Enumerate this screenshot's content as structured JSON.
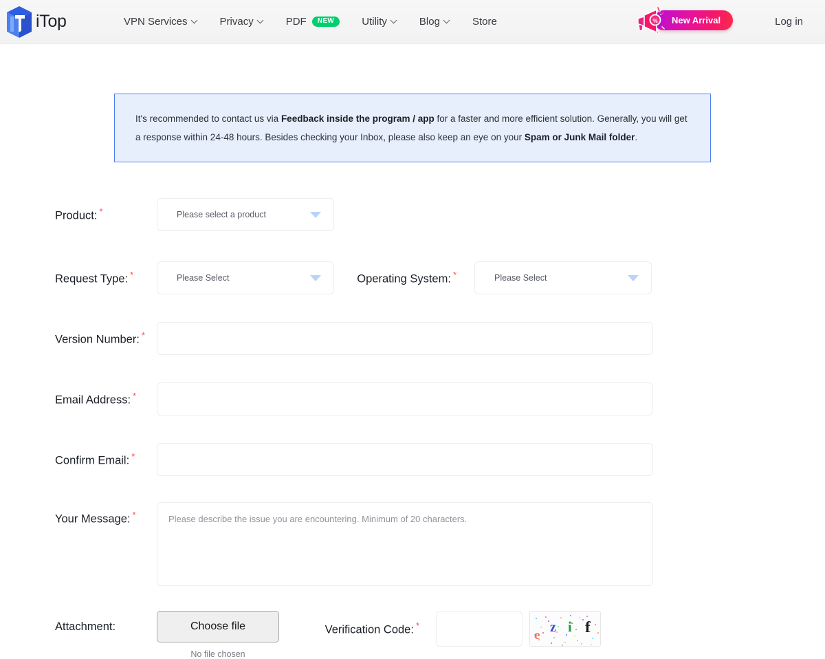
{
  "header": {
    "logo_text": "iTop",
    "logo_icon": "itop-cube-logo",
    "nav": [
      {
        "label": "VPN Services",
        "has_caret": true,
        "badge": null
      },
      {
        "label": "Privacy",
        "has_caret": true,
        "badge": null
      },
      {
        "label": "PDF",
        "has_caret": false,
        "badge": "NEW"
      },
      {
        "label": "Utility",
        "has_caret": true,
        "badge": null
      },
      {
        "label": "Blog",
        "has_caret": true,
        "badge": null
      },
      {
        "label": "Store",
        "has_caret": false,
        "badge": null
      }
    ],
    "arrival_badge": {
      "label": "New Arrival",
      "icon": "megaphone-icon"
    },
    "login_label": "Log in"
  },
  "notice": {
    "part1": "It's recommended to contact us via ",
    "bold1": "Feedback inside the program / app",
    "part2": " for a faster and more efficient solution. Generally, you will get a response within 24-48 hours. Besides checking your Inbox, please also keep an eye on your ",
    "bold2": "Spam or Junk Mail folder",
    "part3": "."
  },
  "form": {
    "product": {
      "label": "Product:",
      "required_mark": "*",
      "value": "Please select a product"
    },
    "request_type": {
      "label": "Request Type:",
      "required_mark": "*",
      "value": "Please Select"
    },
    "operating_system": {
      "label": "Operating System:",
      "required_mark": "*",
      "value": "Please Select"
    },
    "version_number": {
      "label": "Version Number:",
      "required_mark": "*",
      "value": "",
      "placeholder": ""
    },
    "email_address": {
      "label": "Email Address:",
      "required_mark": "*",
      "value": "",
      "placeholder": ""
    },
    "confirm_email": {
      "label": "Confirm Email:",
      "required_mark": "*",
      "value": "",
      "placeholder": ""
    },
    "your_message": {
      "label": "Your Message:",
      "required_mark": "*",
      "value": "",
      "placeholder": "Please describe the issue you are encountering. Minimum of 20 characters."
    },
    "attachment": {
      "label": "Attachment:",
      "button_label": "Choose file",
      "status_text": "No file chosen"
    },
    "verification_code": {
      "label": "Verification Code:",
      "required_mark": "*",
      "value": "",
      "captcha_chars": [
        {
          "char": "e",
          "color": "#f4745f"
        },
        {
          "char": "z",
          "color": "#3f4fd4"
        },
        {
          "char": "i",
          "color": "#1e9e3a"
        },
        {
          "char": "f",
          "color": "#16181c"
        }
      ]
    }
  },
  "colors": {
    "notice_bg": "#e7effd",
    "notice_border": "#4d7fef",
    "new_badge_bg": "#00d06c",
    "required_red": "#ff4d4f",
    "logo_blue": "#2f5fe0",
    "chevron_blue": "#b9d4fb"
  }
}
